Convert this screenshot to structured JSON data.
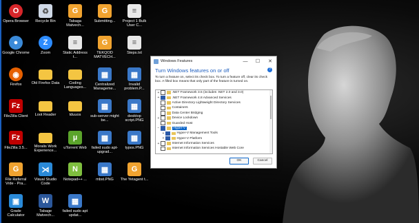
{
  "desktop": {
    "icons": [
      {
        "label": "Opera Browser",
        "icon": "opera-icon",
        "color": "#d7262a"
      },
      {
        "label": "Recycle Bin",
        "icon": "recycle-bin-icon",
        "color": "#cfd8e6"
      },
      {
        "label": "Tabaga Matvech...",
        "icon": "document-icon",
        "color": "#f0a330"
      },
      {
        "label": "Submitting...",
        "icon": "document-icon",
        "color": "#f0a330"
      },
      {
        "label": "Project 1 Bulk User C...",
        "icon": "text-file-icon",
        "color": "#e8e8e8"
      },
      {
        "label": "Google Chrome",
        "icon": "chrome-icon",
        "color": "#3b8ad8"
      },
      {
        "label": "Zoom",
        "icon": "zoom-icon",
        "color": "#2d8cff"
      },
      {
        "label": "Static Address t...",
        "icon": "text-file-icon",
        "color": "#e8e8e8"
      },
      {
        "label": "TEKQOD MATVECH...",
        "icon": "document-icon",
        "color": "#f0a330"
      },
      {
        "label": "Steps.txt",
        "icon": "text-file-icon",
        "color": "#e8e8e8"
      },
      {
        "label": "Firefox",
        "icon": "firefox-icon",
        "color": "#e66000"
      },
      {
        "label": "Old Firefox Data",
        "icon": "folder-icon",
        "color": "#f4c542"
      },
      {
        "label": "Coding Languages...",
        "icon": "folder-icon",
        "color": "#f4c542"
      },
      {
        "label": "Centralized Manageme...",
        "icon": "image-file-icon",
        "color": "#3a78c8"
      },
      {
        "label": "Invalid problem.P...",
        "icon": "image-file-icon",
        "color": "#3a78c8"
      },
      {
        "label": "FileZilla Client",
        "icon": "filezilla-icon",
        "color": "#bf0000"
      },
      {
        "label": "Loot Reader",
        "icon": "folder-icon",
        "color": "#f4c542"
      },
      {
        "label": "tduuos",
        "icon": "folder-icon",
        "color": "#f4c542"
      },
      {
        "label": "sub-server might be...",
        "icon": "image-file-icon",
        "color": "#3a78c8"
      },
      {
        "label": "desktop script.PNG",
        "icon": "image-file-icon",
        "color": "#3a78c8"
      },
      {
        "label": "FileZilla 3.5...",
        "icon": "filezilla-icon",
        "color": "#bf0000"
      },
      {
        "label": "Moralis Work Experience...",
        "icon": "folder-icon",
        "color": "#f4c542"
      },
      {
        "label": "uTorrent Web",
        "icon": "utorrent-icon",
        "color": "#5ba42b"
      },
      {
        "label": "failed sudo apt-upgrad...",
        "icon": "image-file-icon",
        "color": "#3a78c8"
      },
      {
        "label": "typos.PNG",
        "icon": "image-file-icon",
        "color": "#3a78c8"
      },
      {
        "label": "File Referral Vrde - Pra...",
        "icon": "document-icon",
        "color": "#f0a330"
      },
      {
        "label": "Visual Studio Code",
        "icon": "vscode-icon",
        "color": "#2a8ad8"
      },
      {
        "label": "Notepad++ ...",
        "icon": "notepadpp-icon",
        "color": "#7fbf3f"
      },
      {
        "label": "mbst.PNG",
        "icon": "image-file-icon",
        "color": "#3a78c8"
      },
      {
        "label": "The Yetagent t...",
        "icon": "document-icon",
        "color": "#f0a330"
      },
      {
        "label": "Grade Calculator",
        "icon": "app-icon",
        "color": "#2a8ad8"
      },
      {
        "label": "Tabage Matvech...",
        "icon": "word-icon",
        "color": "#2b579a"
      },
      {
        "label": "failed sudo apt updat...",
        "icon": "image-file-icon",
        "color": "#3a78c8"
      }
    ]
  },
  "dialog": {
    "title": "Windows Features",
    "minimize": "—",
    "maximize": "☐",
    "close": "✕",
    "heading": "Turn Windows features on or off",
    "help": "?",
    "description": "To turn a feature on, select its check box. To turn a feature off, clear its check box. A filled box means that only part of the feature is turned on.",
    "features": [
      {
        "label": ".NET Framework 3.5 (includes .NET 2.0 and 3.0)",
        "expand": "+",
        "state": "off",
        "indent": 0
      },
      {
        "label": ".NET Framework 4.8 Advanced Services",
        "expand": "+",
        "state": "part",
        "indent": 0
      },
      {
        "label": "Active Directory Lightweight Directory Services",
        "expand": "",
        "state": "off",
        "indent": 0
      },
      {
        "label": "Containers",
        "expand": "",
        "state": "off",
        "indent": 0
      },
      {
        "label": "Data Center Bridging",
        "expand": "",
        "state": "off",
        "indent": 0
      },
      {
        "label": "Device Lockdown",
        "expand": "+",
        "state": "off",
        "indent": 0
      },
      {
        "label": "Guarded Host",
        "expand": "",
        "state": "off",
        "indent": 0
      },
      {
        "label": "Hyper-V",
        "expand": "−",
        "state": "on",
        "indent": 0,
        "selected": true
      },
      {
        "label": "Hyper-V Management Tools",
        "expand": "+",
        "state": "on",
        "indent": 1
      },
      {
        "label": "Hyper-V Platform",
        "expand": "+",
        "state": "on",
        "indent": 1
      },
      {
        "label": "Internet Information Services",
        "expand": "+",
        "state": "off",
        "indent": 0
      },
      {
        "label": "Internet Information Services Hostable Web Core",
        "expand": "",
        "state": "off",
        "indent": 0
      }
    ],
    "ok_label": "OK",
    "cancel_label": "Cancel"
  }
}
